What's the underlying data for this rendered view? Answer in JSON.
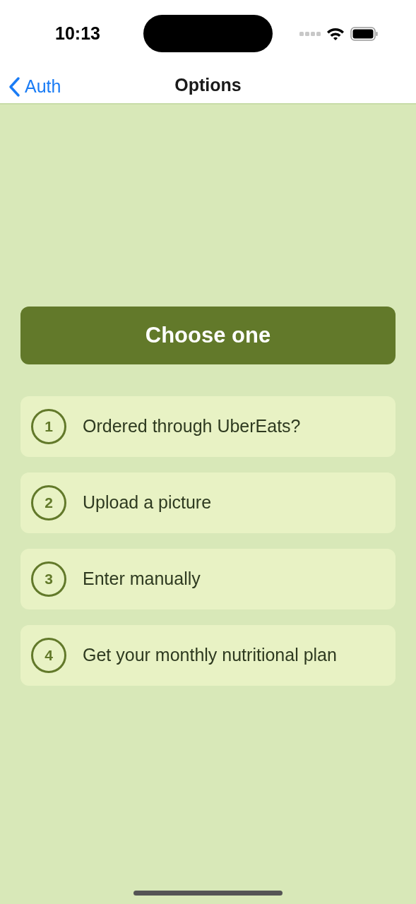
{
  "status_bar": {
    "time": "10:13"
  },
  "nav": {
    "back": "Auth",
    "title": "Options"
  },
  "header": "Choose one",
  "options": [
    {
      "number": "1",
      "label": "Ordered through UberEats?"
    },
    {
      "number": "2",
      "label": "Upload a picture"
    },
    {
      "number": "3",
      "label": "Enter manually"
    },
    {
      "number": "4",
      "label": "Get your monthly nutritional plan"
    }
  ]
}
